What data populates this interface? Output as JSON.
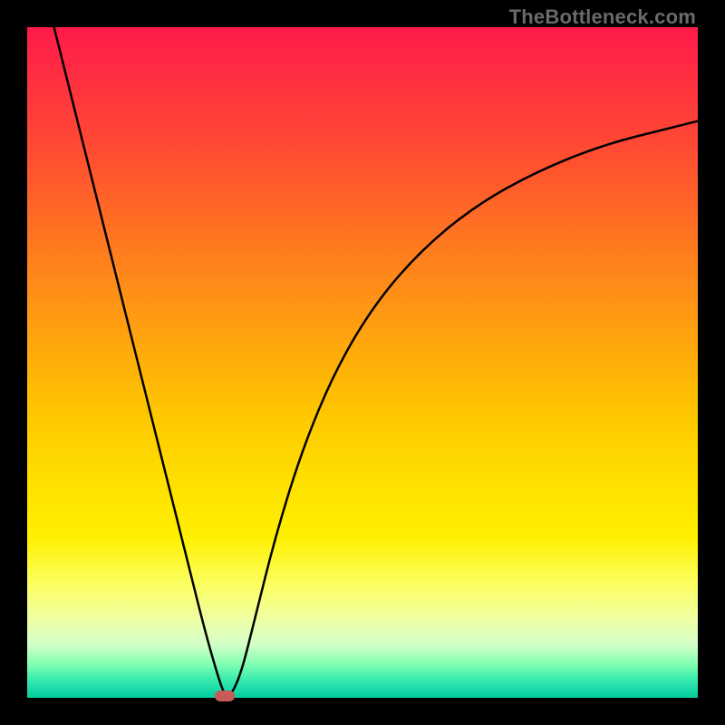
{
  "watermark": "TheBottleneck.com",
  "chart_data": {
    "type": "line",
    "title": "",
    "xlabel": "",
    "ylabel": "",
    "x_range": [
      0,
      100
    ],
    "y_range": [
      0,
      100
    ],
    "curve_points": [
      {
        "x": 4.0,
        "y": 100.0
      },
      {
        "x": 6.0,
        "y": 92.0
      },
      {
        "x": 9.0,
        "y": 80.0
      },
      {
        "x": 12.0,
        "y": 68.0
      },
      {
        "x": 15.0,
        "y": 56.0
      },
      {
        "x": 18.0,
        "y": 44.0
      },
      {
        "x": 21.0,
        "y": 32.0
      },
      {
        "x": 24.0,
        "y": 20.0
      },
      {
        "x": 26.5,
        "y": 10.0
      },
      {
        "x": 28.5,
        "y": 3.0
      },
      {
        "x": 29.5,
        "y": 0.3
      },
      {
        "x": 30.5,
        "y": 0.5
      },
      {
        "x": 32.0,
        "y": 4.0
      },
      {
        "x": 34.0,
        "y": 12.0
      },
      {
        "x": 37.0,
        "y": 24.0
      },
      {
        "x": 41.0,
        "y": 37.0
      },
      {
        "x": 46.0,
        "y": 49.0
      },
      {
        "x": 52.0,
        "y": 59.0
      },
      {
        "x": 59.0,
        "y": 67.0
      },
      {
        "x": 67.0,
        "y": 73.5
      },
      {
        "x": 76.0,
        "y": 78.5
      },
      {
        "x": 86.0,
        "y": 82.5
      },
      {
        "x": 96.0,
        "y": 85.0
      },
      {
        "x": 100.0,
        "y": 86.0
      }
    ],
    "minimum_point": {
      "x": 29.5,
      "y": 0.3
    },
    "gradient_stops": [
      {
        "pos": 0.0,
        "color": "#ff1a4a"
      },
      {
        "pos": 0.45,
        "color": "#ffc800"
      },
      {
        "pos": 0.76,
        "color": "#fff000"
      },
      {
        "pos": 1.0,
        "color": "#00cc99"
      }
    ]
  }
}
